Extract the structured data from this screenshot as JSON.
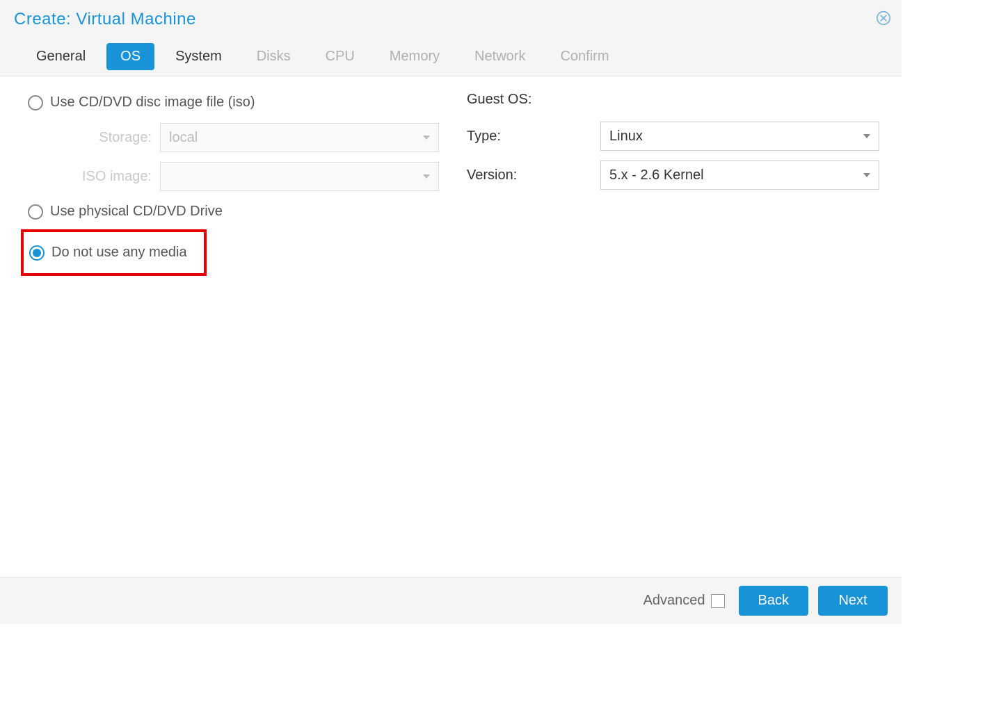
{
  "dialog": {
    "title": "Create: Virtual Machine"
  },
  "tabs": {
    "general": "General",
    "os": "OS",
    "system": "System",
    "disks": "Disks",
    "cpu": "CPU",
    "memory": "Memory",
    "network": "Network",
    "confirm": "Confirm"
  },
  "media": {
    "option_iso": "Use CD/DVD disc image file (iso)",
    "option_physical": "Use physical CD/DVD Drive",
    "option_none": "Do not use any media",
    "storage_label": "Storage:",
    "storage_value": "local",
    "iso_label": "ISO image:",
    "iso_value": ""
  },
  "guestos": {
    "heading": "Guest OS:",
    "type_label": "Type:",
    "type_value": "Linux",
    "version_label": "Version:",
    "version_value": "5.x - 2.6 Kernel"
  },
  "footer": {
    "advanced": "Advanced",
    "back": "Back",
    "next": "Next"
  }
}
